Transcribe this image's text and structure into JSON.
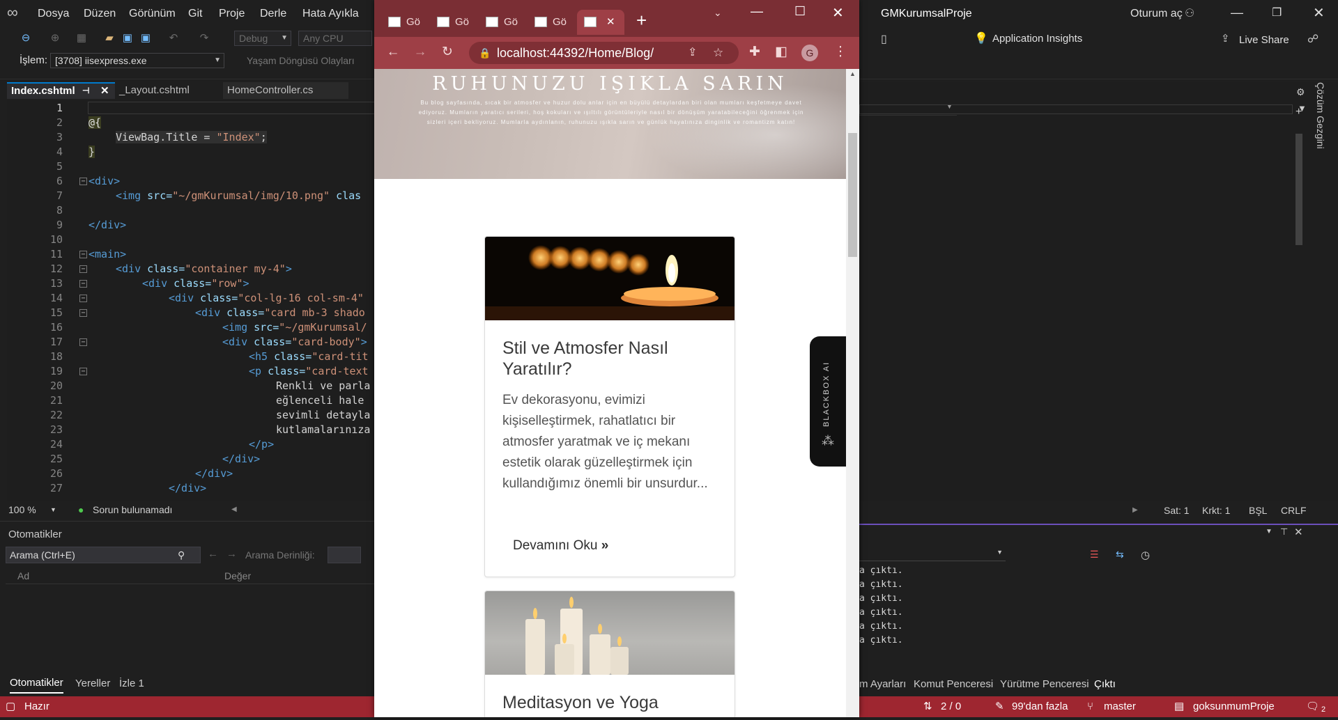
{
  "vs": {
    "menu": [
      "Dosya",
      "Düzen",
      "Görünüm",
      "Git",
      "Proje",
      "Derle",
      "Hata Ayıkla"
    ],
    "solution_name": "GMKurumsalProje",
    "sign_in": "Oturum aç",
    "toolbar": {
      "config": "Debug",
      "platform": "Any CPU",
      "process_label": "İşlem:",
      "process_value": "[3708] iisexpress.exe",
      "lifecycle": "Yaşam Döngüsü Olayları",
      "app_insights": "Application Insights",
      "live_share": "Live Share"
    },
    "tabs": [
      {
        "label": "Index.cshtml",
        "active": true
      },
      {
        "label": "_Layout.cshtml",
        "active": false
      },
      {
        "label": "HomeController.cs",
        "active": false
      }
    ],
    "code_lines": [
      "1",
      "2",
      "3",
      "4",
      "5",
      "6",
      "7",
      "8",
      "9",
      "10",
      "11",
      "12",
      "13",
      "14",
      "15",
      "16",
      "17",
      "18",
      "19",
      "20",
      "21",
      "22",
      "23",
      "24",
      "25",
      "26",
      "27"
    ],
    "code": {
      "l2": "@{",
      "l3a": "ViewBag.Title = ",
      "l3b": "\"Index\"",
      "l3c": ";",
      "l4": "}",
      "l6": "<div>",
      "l7a": "<img ",
      "l7b": "src=",
      "l7c": "\"~/gmKurumsal/img/10.png\"",
      "l7d": " clas",
      "l9": "</div>",
      "l11": "<main>",
      "l12a": "<div ",
      "l12b": "class=",
      "l12c": "\"container my-4\"",
      "l12d": ">",
      "l13a": "<div ",
      "l13b": "class=",
      "l13c": "\"row\"",
      "l13d": ">",
      "l14a": "<div ",
      "l14b": "class=",
      "l14c": "\"col-lg-16 col-sm-4\"",
      "l15a": "<div ",
      "l15b": "class=",
      "l15c": "\"card mb-3 shado",
      "l16a": "<img ",
      "l16b": "src=",
      "l16c": "\"~/gmKurumsal/",
      "l17a": "<div ",
      "l17b": "class=",
      "l17c": "\"card-body\"",
      "l17d": ">",
      "l18a": "<h5 ",
      "l18b": "class=",
      "l18c": "\"card-tit",
      "l19a": "<p ",
      "l19b": "class=",
      "l19c": "\"card-text",
      "l20": "Renkli ve parla",
      "l21": "eğlenceli hale ",
      "l22": "sevimli detayla",
      "l23": "kutlamalarınıza",
      "l24": "</p>",
      "l25": "</div>",
      "l26": "</div>",
      "l27": "</div>"
    },
    "zoom": "100 %",
    "no_issues": "Sorun bulunamadı",
    "right_status": {
      "line": "Sat: 1",
      "col": "Krkt: 1",
      "mode": "BŞL",
      "eol": "CRLF"
    },
    "autos": {
      "title": "Otomatikler",
      "search_placeholder": "Arama (Ctrl+E)",
      "depth_label": "Arama Derinliği:",
      "col_name": "Ad",
      "col_value": "Değer",
      "bottom_tabs": [
        "Otomatikler",
        "Yereller",
        "İzle 1"
      ]
    },
    "output": {
      "lines": [
        "a çıktı.",
        "a çıktı.",
        "a çıktı.",
        "a çıktı.",
        "a çıktı.",
        "a çıktı."
      ],
      "bottom_tabs": [
        "m Ayarları",
        "Komut Penceresi",
        "Yürütme Penceresi",
        "Çıktı"
      ]
    },
    "statusbar": {
      "ready": "Hazır",
      "sync": "2 / 0",
      "pending": "99'dan fazla",
      "branch": "master",
      "repo": "goksunmumProje",
      "notifications": "2"
    },
    "side_panel": "Çözüm Gezgini"
  },
  "browser": {
    "tab_label": "Gö",
    "tab_count": 5,
    "url": "localhost:44392/Home/Blog/",
    "profile_initial": "G",
    "hero_title": "RUHUNUZU IŞIKLA SARIN",
    "hero_text": "Bu blog sayfasında, sıcak bir atmosfer ve huzur dolu anlar için en büyülü detaylardan biri olan mumları keşfetmeye davet ediyoruz. Mumların yaratıcı serileri, hoş kokuları ve ışıltılı görüntüleriyle nasıl bir dönüşüm yaratabileceğini öğrenmek için sizleri içeri bekliyoruz. Mumlarla aydınlanın, ruhunuzu ışıkla sarın ve günlük hayatınıza dinginlik ve romantizm katın!",
    "cards": [
      {
        "title": "Stil ve Atmosfer Nasıl Yaratılır?",
        "text": "Ev dekorasyonu, evimizi kişiselleştirmek, rahatlatıcı bir atmosfer yaratmak ve iç mekanı estetik olarak güzelleştirmek için kullandığımız önemli bir unsurdur...",
        "link": "Devamını Oku"
      },
      {
        "title": "Meditasyon ve Yoga",
        "text": "",
        "link": ""
      }
    ],
    "side_widget": "BLACKBOX AI"
  },
  "colors": {
    "status_bar": "#9e2630",
    "browser_frame": "#9e3f46",
    "browser_tabs": "#7a2e34",
    "output_accent": "#6b4fbb"
  }
}
